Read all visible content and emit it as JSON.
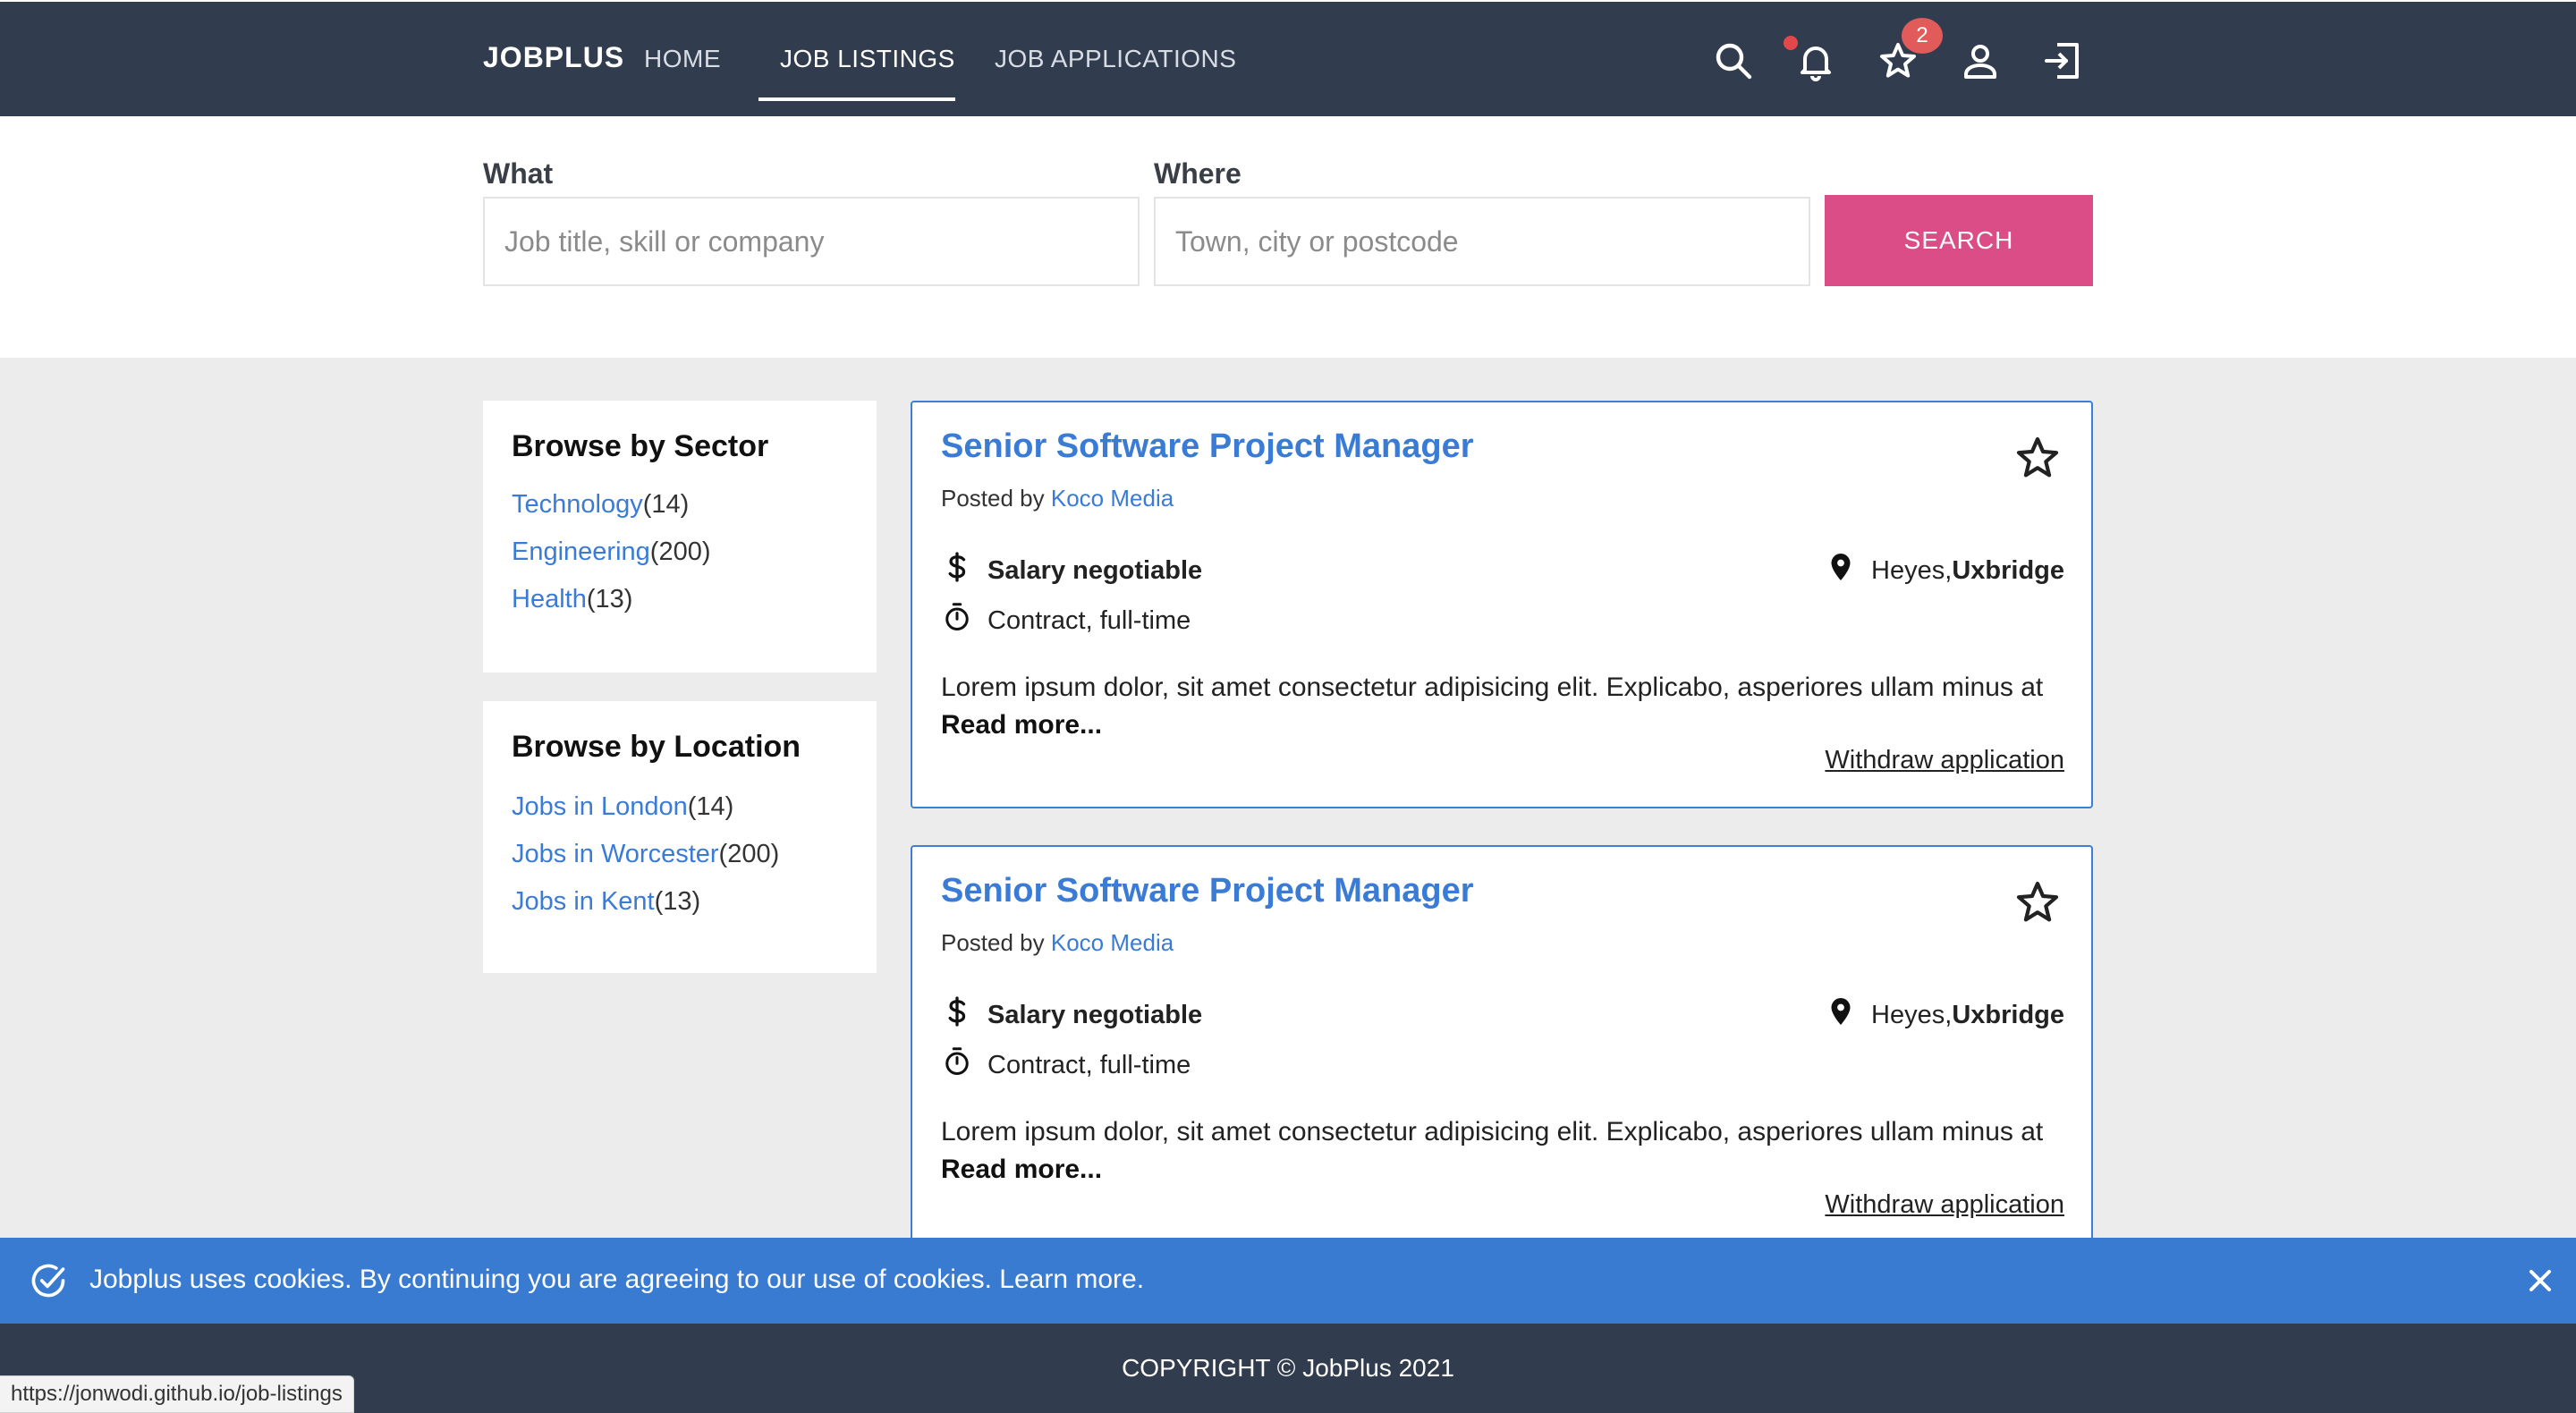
{
  "nav": {
    "brand": "JOBPLUS",
    "links": [
      {
        "label": "HOME"
      },
      {
        "label": "JOB LISTINGS"
      },
      {
        "label": "JOB APPLICATIONS"
      }
    ],
    "icons": [
      "search-icon",
      "bell-icon",
      "star-icon",
      "user-icon",
      "logout-icon"
    ],
    "favorites_badge": "2"
  },
  "search": {
    "what_label": "What",
    "what_placeholder": "Job title, skill or company",
    "where_label": "Where",
    "where_placeholder": "Town, city or postcode",
    "button_label": "SEARCH"
  },
  "sidebar": {
    "sector": {
      "title": "Browse by Sector",
      "items": [
        {
          "label": "Technology",
          "count": "(14)"
        },
        {
          "label": "Engineering",
          "count": "(200)"
        },
        {
          "label": "Health",
          "count": "(13)"
        }
      ]
    },
    "location": {
      "title": "Browse by Location",
      "items": [
        {
          "label": "Jobs in London",
          "count": "(14)"
        },
        {
          "label": "Jobs in Worcester",
          "count": "(200)"
        },
        {
          "label": "Jobs in Kent",
          "count": "(13)"
        }
      ]
    }
  },
  "jobs": [
    {
      "title": "Senior Software Project Manager",
      "posted_prefix": "Posted by",
      "company": "Koco Media",
      "salary": "Salary negotiable",
      "type": "Contract, full-time",
      "location_area": "Heyes,",
      "location_city": "Uxbridge",
      "description": "Lorem ipsum dolor, sit amet consectetur adipisicing elit. Explicabo, asperiores ullam minus at",
      "read_more": "Read more...",
      "action": "Withdraw application"
    },
    {
      "title": "Senior Software Project Manager",
      "posted_prefix": "Posted by",
      "company": "Koco Media",
      "salary": "Salary negotiable",
      "type": "Contract, full-time",
      "location_area": "Heyes,",
      "location_city": "Uxbridge",
      "description": "Lorem ipsum dolor, sit amet consectetur adipisicing elit. Explicabo, asperiores ullam minus at",
      "read_more": "Read more...",
      "action": "Withdraw application"
    }
  ],
  "cookie": {
    "text": "Jobplus uses cookies. By continuing you are agreeing to our use of cookies. Learn more."
  },
  "footer": {
    "copyright": "COPYRIGHT © JobPlus 2021"
  },
  "status_bar": {
    "url": "https://jonwodi.github.io/job-listings"
  },
  "colors": {
    "navbar": "#313d4f",
    "accent": "#3a7bd5",
    "search_button": "#da4d87",
    "badge": "#e25b5b"
  }
}
